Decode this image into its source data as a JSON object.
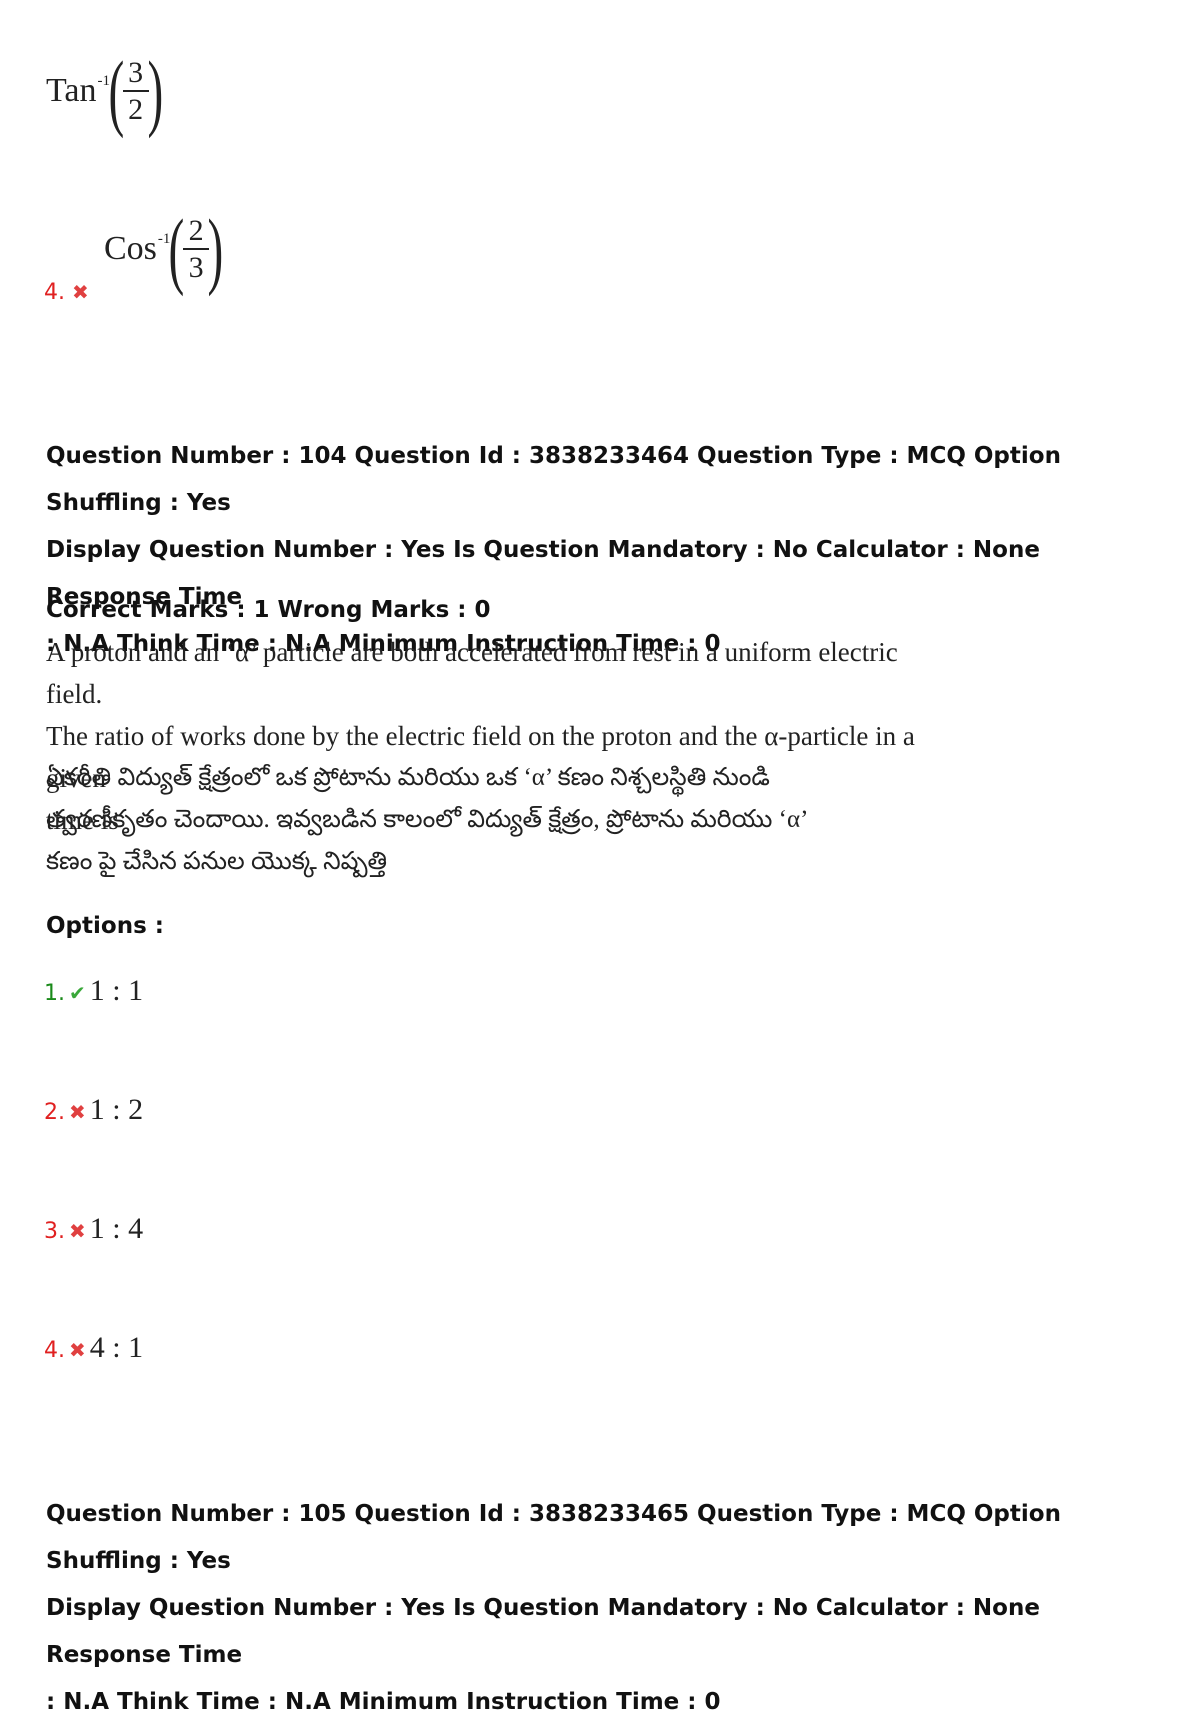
{
  "prev_question": {
    "option3": {
      "fn": "Tan",
      "exp": "-1",
      "num": "3",
      "den": "2"
    },
    "option4": {
      "number": "4.",
      "fn": "Cos",
      "exp": "-1",
      "num": "2",
      "den": "3"
    }
  },
  "q104": {
    "meta_line1": "Question Number : 104 Question Id : 3838233464 Question Type : MCQ Option Shuffling : Yes",
    "meta_line2": "Display Question Number : Yes Is Question Mandatory : No Calculator : None Response Time",
    "meta_line3": ": N.A Think Time : N.A Minimum Instruction Time : 0",
    "marks": "Correct Marks : 1 Wrong Marks : 0",
    "english_line1": "A proton and an ‘α’ particle are both accelerated from rest in a uniform electric field.",
    "english_line2": "The ratio of works done by the electric field on the proton and the α-particle in a given",
    "english_line3": "time is",
    "telugu_line1": "ఏకరీతి విద్యుత్ క్షేత్రంలో ఒక ప్రోటాను మరియు ఒక ‘α’ కణం నిశ్చలస్థితి నుండి",
    "telugu_line2": "త్వరణీకృతం చెందాయి. ఇవ్వబడిన కాలంలో విద్యుత్ క్షేత్రం, ప్రోటాను మరియు ‘α’",
    "telugu_line3": "కణం పై చేసిన పనుల యొక్క నిష్పత్తి",
    "options_label": "Options :",
    "options": [
      {
        "number": "1.",
        "text": "1 : 1",
        "correct": true,
        "icon": "check-icon"
      },
      {
        "number": "2.",
        "text": "1 : 2",
        "correct": false,
        "icon": "cross-icon"
      },
      {
        "number": "3.",
        "text": "1 : 4",
        "correct": false,
        "icon": "cross-icon"
      },
      {
        "number": "4.",
        "text": "4 : 1",
        "correct": false,
        "icon": "cross-icon"
      }
    ]
  },
  "q105": {
    "meta_line1": "Question Number : 105 Question Id : 3838233465 Question Type : MCQ Option Shuffling : Yes",
    "meta_line2": "Display Question Number : Yes Is Question Mandatory : No Calculator : None Response Time",
    "meta_line3": ": N.A Think Time : N.A Minimum Instruction Time : 0"
  },
  "colors": {
    "correct": "#1a8a1a",
    "wrong": "#e02020",
    "check": "#3aa83a",
    "cross": "#e04040"
  }
}
